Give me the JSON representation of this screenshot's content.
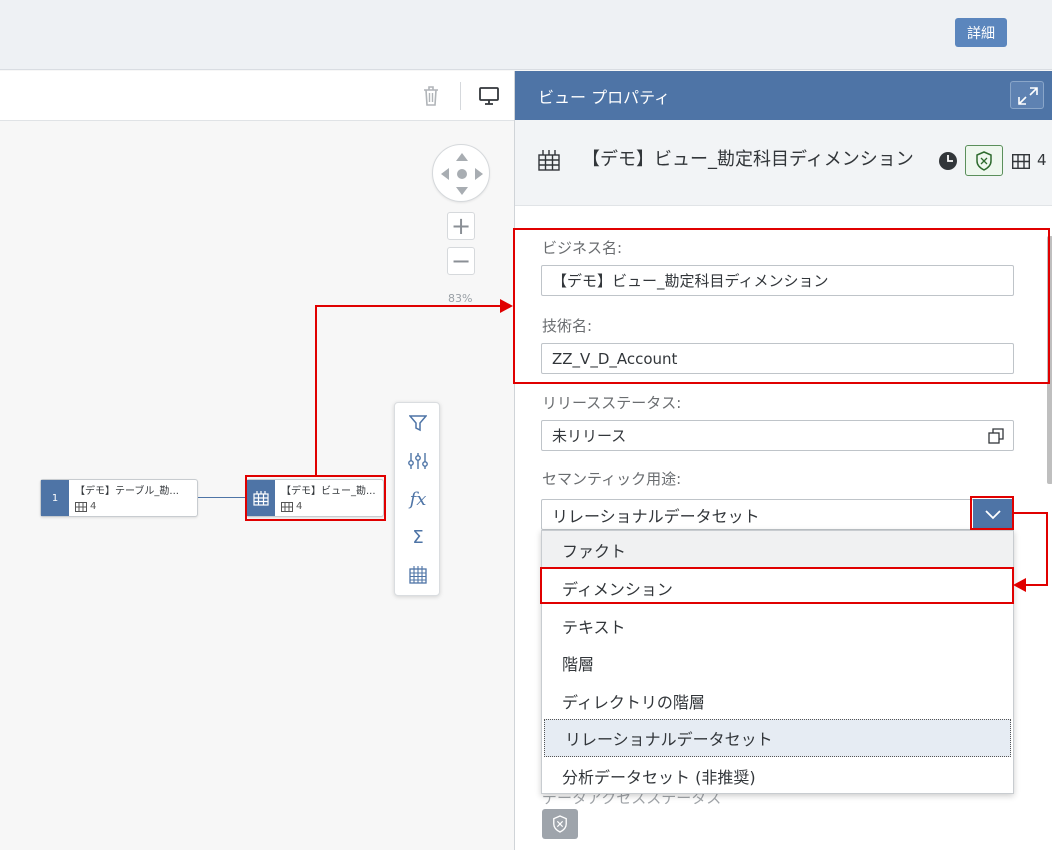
{
  "topbar": {
    "detail_label": "詳細"
  },
  "canvas": {
    "zoom_level": "83%",
    "zoom_in": "+",
    "zoom_out": "−",
    "source_node": {
      "index": "1",
      "title": "【デモ】テーブル_勘...",
      "column_count": "4"
    },
    "view_node": {
      "title": "【デモ】ビュー_勘...",
      "column_count": "4"
    },
    "tools": [
      "filter-icon",
      "calculated-columns-icon",
      "function-icon",
      "aggregation-icon",
      "table-icon"
    ]
  },
  "panel": {
    "title": "ビュー プロパティ",
    "object_title": "【デモ】ビュー_勘定科目ディメンション",
    "object_column_count": "4",
    "business_name_label": "ビジネス名:",
    "business_name_value": "【デモ】ビュー_勘定科目ディメンション",
    "technical_name_label": "技術名:",
    "technical_name_value": "ZZ_V_D_Account",
    "release_status_label": "リリースステータス:",
    "release_status_value": "未リリース",
    "semantic_usage_label": "セマンティック用途:",
    "semantic_usage_value": "リレーショナルデータセット",
    "semantic_options": [
      {
        "label": "ファクト"
      },
      {
        "label": "ディメンション"
      },
      {
        "label": "テキスト"
      },
      {
        "label": "階層"
      },
      {
        "label": "ディレクトリの階層"
      },
      {
        "label": "リレーショナルデータセット"
      },
      {
        "label": "分析データセット (非推奨)"
      }
    ],
    "hidden_label": "データアクセスステータス"
  },
  "colors": {
    "brand": "#4e74a6",
    "highlight": "#e00000",
    "accent_button": "#5b86bd"
  }
}
